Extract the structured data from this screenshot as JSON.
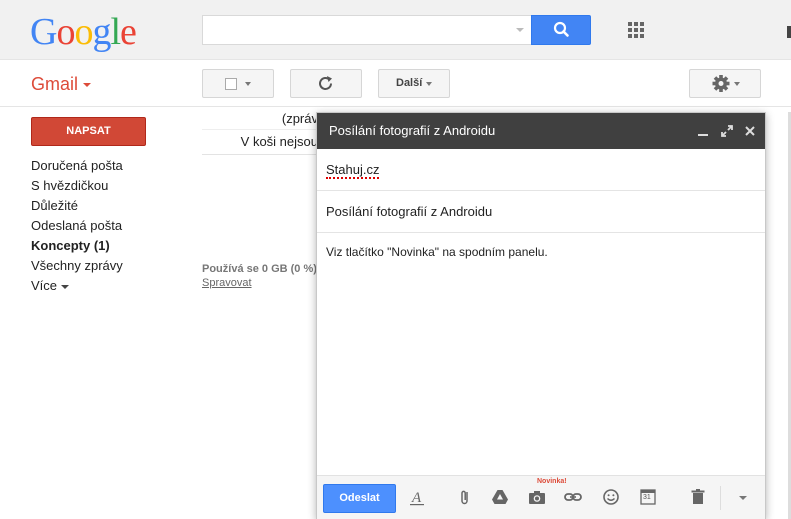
{
  "header": {
    "logo": {
      "letters": [
        {
          "ch": "G",
          "color": "#4285f4"
        },
        {
          "ch": "o",
          "color": "#ea4335"
        },
        {
          "ch": "o",
          "color": "#fbbc05"
        },
        {
          "ch": "g",
          "color": "#4285f4"
        },
        {
          "ch": "l",
          "color": "#34a853"
        },
        {
          "ch": "e",
          "color": "#ea4335"
        }
      ]
    },
    "search": {
      "value": "",
      "placeholder": ""
    }
  },
  "toolbar": {
    "app_label": "Gmail",
    "more_label": "Další"
  },
  "sidebar": {
    "compose_label": "NAPSAT",
    "items": [
      {
        "label": "Doručená pošta",
        "bold": false
      },
      {
        "label": "S hvězdičkou",
        "bold": false
      },
      {
        "label": "Důležité",
        "bold": false
      },
      {
        "label": "Odeslaná pošta",
        "bold": false
      },
      {
        "label": "Koncepty (1)",
        "bold": true
      },
      {
        "label": "Všechny zprávy",
        "bold": false
      }
    ],
    "more_label": "Více"
  },
  "main": {
    "line1": "(zpráv",
    "line2": "V koši nejsou",
    "usage": "Používá se 0 GB (0 %)",
    "manage": "Spravovat"
  },
  "compose": {
    "title": "Posílání fotografií z Androidu",
    "to": "Stahuj.cz",
    "subject": "Posílání fotografií z Androidu",
    "body": "Viz tlačítko \"Novinka\" na spodním panelu.",
    "send_label": "Odeslat",
    "new_badge": "Novinka!",
    "calendar_day": "31"
  },
  "colors": {
    "accent_blue": "#4d90fe",
    "gmail_red": "#dd4b39",
    "compose_red": "#d14836",
    "dialog_header": "#404040"
  }
}
